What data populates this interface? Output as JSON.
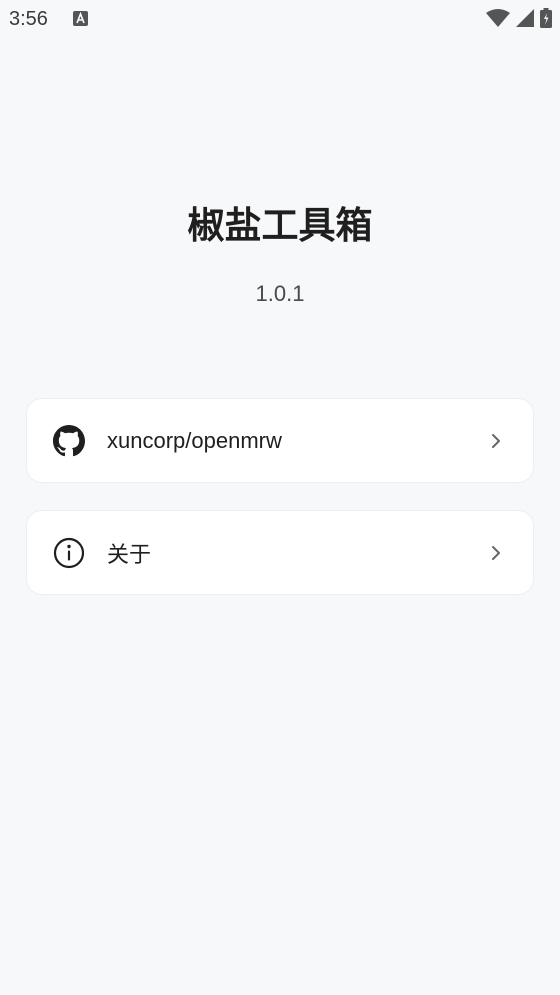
{
  "status_bar": {
    "time": "3:56"
  },
  "app": {
    "title": "椒盐工具箱",
    "version": "1.0.1"
  },
  "links": [
    {
      "label": "xuncorp/openmrw",
      "icon": "github-icon"
    },
    {
      "label": "关于",
      "icon": "info-icon"
    }
  ],
  "colors": {
    "background": "#f7f8fa",
    "card": "#ffffff",
    "text": "#1f1f1f",
    "muted": "#4a4a4a"
  }
}
